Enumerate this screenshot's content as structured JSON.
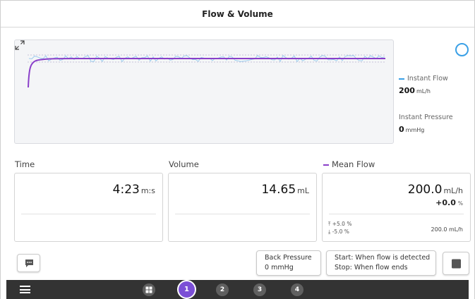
{
  "title": "Flow & Volume",
  "colors": {
    "accent": "#7b4fd6",
    "instant_flow": "#3aa0e6",
    "mean_flow": "#8a3fc9",
    "spinner": "#3aa0e6"
  },
  "side_info": {
    "instant_flow": {
      "label": "Instant Flow",
      "value": "200",
      "unit": "mL/h"
    },
    "instant_pressure": {
      "label": "Instant Pressure",
      "value": "0",
      "unit": "mmHg"
    }
  },
  "time": {
    "label": "Time",
    "value": "4:23",
    "unit": "m:s"
  },
  "volume": {
    "label": "Volume",
    "value": "14.65",
    "unit": "mL"
  },
  "mean_flow": {
    "label": "Mean Flow",
    "value": "200.0",
    "unit": "mL/h",
    "deviation": "+0.0",
    "deviation_unit": "%",
    "tol_up": "+5.0 %",
    "tol_down": "-5.0 %",
    "target": "200.0  mL/h"
  },
  "buttons": {
    "back_pressure_line1": "Back Pressure",
    "back_pressure_line2": "0 mmHg",
    "start_line": "Start: When flow is detected",
    "stop_line": "Stop: When flow ends"
  },
  "nav": {
    "steps": [
      "1",
      "2",
      "3",
      "4"
    ],
    "active_step": "1"
  },
  "icons": {
    "expand": "expand-icon",
    "chat": "comment-icon",
    "stop": "stop-icon",
    "menu": "menu-icon",
    "grid": "grid-icon",
    "spinner": "loading-spinner-icon",
    "tol_up": "arrow-up-bar-icon",
    "tol_down": "arrow-down-bar-icon"
  }
}
